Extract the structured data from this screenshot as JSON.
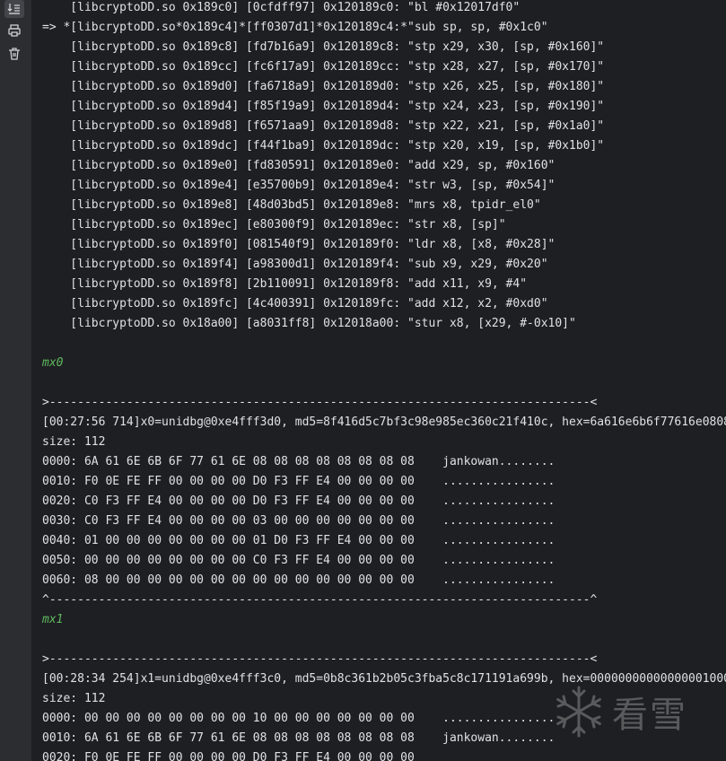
{
  "toolbar": {
    "icons": [
      "scroll-to-end-icon",
      "print-icon",
      "trash-icon"
    ]
  },
  "console": {
    "lines": [
      {
        "text": "    [libcryptoDD.so 0x189c0] [0cfdff97] 0x120189c0: \"bl #0x12017df0\"",
        "style": "normal"
      },
      {
        "text": "=> *[libcryptoDD.so*0x189c4]*[ff0307d1]*0x120189c4:*\"sub sp, sp, #0x1c0\"",
        "style": "normal"
      },
      {
        "text": "    [libcryptoDD.so 0x189c8] [fd7b16a9] 0x120189c8: \"stp x29, x30, [sp, #0x160]\"",
        "style": "normal"
      },
      {
        "text": "    [libcryptoDD.so 0x189cc] [fc6f17a9] 0x120189cc: \"stp x28, x27, [sp, #0x170]\"",
        "style": "normal"
      },
      {
        "text": "    [libcryptoDD.so 0x189d0] [fa6718a9] 0x120189d0: \"stp x26, x25, [sp, #0x180]\"",
        "style": "normal"
      },
      {
        "text": "    [libcryptoDD.so 0x189d4] [f85f19a9] 0x120189d4: \"stp x24, x23, [sp, #0x190]\"",
        "style": "normal"
      },
      {
        "text": "    [libcryptoDD.so 0x189d8] [f6571aa9] 0x120189d8: \"stp x22, x21, [sp, #0x1a0]\"",
        "style": "normal"
      },
      {
        "text": "    [libcryptoDD.so 0x189dc] [f44f1ba9] 0x120189dc: \"stp x20, x19, [sp, #0x1b0]\"",
        "style": "normal"
      },
      {
        "text": "    [libcryptoDD.so 0x189e0] [fd830591] 0x120189e0: \"add x29, sp, #0x160\"",
        "style": "normal"
      },
      {
        "text": "    [libcryptoDD.so 0x189e4] [e35700b9] 0x120189e4: \"str w3, [sp, #0x54]\"",
        "style": "normal"
      },
      {
        "text": "    [libcryptoDD.so 0x189e8] [48d03bd5] 0x120189e8: \"mrs x8, tpidr_el0\"",
        "style": "normal"
      },
      {
        "text": "    [libcryptoDD.so 0x189ec] [e80300f9] 0x120189ec: \"str x8, [sp]\"",
        "style": "normal"
      },
      {
        "text": "    [libcryptoDD.so 0x189f0] [081540f9] 0x120189f0: \"ldr x8, [x8, #0x28]\"",
        "style": "normal"
      },
      {
        "text": "    [libcryptoDD.so 0x189f4] [a98300d1] 0x120189f4: \"sub x9, x29, #0x20\"",
        "style": "normal"
      },
      {
        "text": "    [libcryptoDD.so 0x189f8] [2b110091] 0x120189f8: \"add x11, x9, #4\"",
        "style": "normal"
      },
      {
        "text": "    [libcryptoDD.so 0x189fc] [4c400391] 0x120189fc: \"add x12, x2, #0xd0\"",
        "style": "normal"
      },
      {
        "text": "    [libcryptoDD.so 0x18a00] [a8031ff8] 0x12018a00: \"stur x8, [x29, #-0x10]\"",
        "style": "normal"
      },
      {
        "text": "",
        "style": "normal"
      },
      {
        "text": "mx0",
        "style": "green"
      },
      {
        "text": "",
        "style": "normal"
      },
      {
        "text": ">-----------------------------------------------------------------------------<",
        "style": "normal"
      },
      {
        "text": "[00:27:56 714]x0=unidbg@0xe4fff3d0, md5=8f416d5c7bf3c98e985ec360c21f410c, hex=6a616e6b6f77616e0808",
        "style": "normal"
      },
      {
        "text": "size: 112",
        "style": "normal"
      },
      {
        "text": "0000: 6A 61 6E 6B 6F 77 61 6E 08 08 08 08 08 08 08 08    jankowan........",
        "style": "normal"
      },
      {
        "text": "0010: F0 0E FE FF 00 00 00 00 D0 F3 FF E4 00 00 00 00    ................",
        "style": "normal"
      },
      {
        "text": "0020: C0 F3 FF E4 00 00 00 00 D0 F3 FF E4 00 00 00 00    ................",
        "style": "normal"
      },
      {
        "text": "0030: C0 F3 FF E4 00 00 00 00 03 00 00 00 00 00 00 00    ................",
        "style": "normal"
      },
      {
        "text": "0040: 01 00 00 00 00 00 00 00 01 D0 F3 FF E4 00 00 00    ................",
        "style": "normal"
      },
      {
        "text": "0050: 00 00 00 00 00 00 00 00 C0 F3 FF E4 00 00 00 00    ................",
        "style": "normal"
      },
      {
        "text": "0060: 08 00 00 00 00 00 00 00 00 00 00 00 00 00 00 00    ................",
        "style": "normal"
      },
      {
        "text": "^-----------------------------------------------------------------------------^",
        "style": "normal"
      },
      {
        "text": "mx1",
        "style": "green"
      },
      {
        "text": "",
        "style": "normal"
      },
      {
        "text": ">-----------------------------------------------------------------------------<",
        "style": "normal"
      },
      {
        "text": "[00:28:34 254]x1=unidbg@0xe4fff3c0, md5=0b8c361b2b05c3fba5c8c171191a699b, hex=00000000000000001000",
        "style": "normal"
      },
      {
        "text": "size: 112",
        "style": "normal"
      },
      {
        "text": "0000: 00 00 00 00 00 00 00 00 10 00 00 00 00 00 00 00    ................",
        "style": "normal"
      },
      {
        "text": "0010: 6A 61 6E 6B 6F 77 61 6E 08 08 08 08 08 08 08 08    jankowan........",
        "style": "normal"
      },
      {
        "text": "0020: F0 0E FE FF 00 00 00 00 D0 F3 FF E4 00 00 00 00",
        "style": "normal"
      }
    ]
  },
  "watermark": {
    "text": "看雪",
    "icon": "snowflake-logo-icon"
  }
}
